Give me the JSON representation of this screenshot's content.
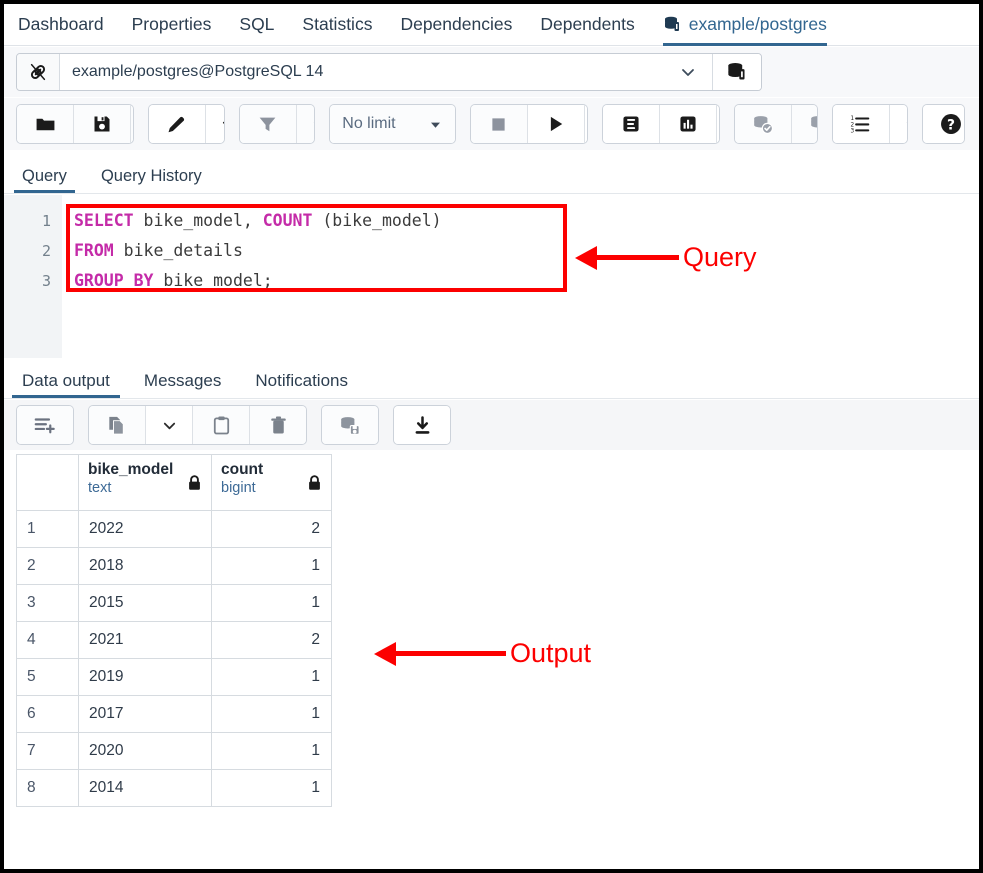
{
  "object_tabs": [
    {
      "label": "Dashboard",
      "active": false,
      "icon": null
    },
    {
      "label": "Properties",
      "active": false,
      "icon": null
    },
    {
      "label": "SQL",
      "active": false,
      "icon": null
    },
    {
      "label": "Statistics",
      "active": false,
      "icon": null
    },
    {
      "label": "Dependencies",
      "active": false,
      "icon": null
    },
    {
      "label": "Dependents",
      "active": false,
      "icon": null
    },
    {
      "label": "example/postgres",
      "active": true,
      "icon": "database-icon"
    }
  ],
  "connection_bar": {
    "link_icon": "connection-link-icon",
    "value": "example/postgres@PostgreSQL 14",
    "dropdown_caret": "⌄",
    "server_icon": "database-server-icon"
  },
  "toolbar": {
    "groups": [
      {
        "buttons": [
          {
            "name": "open-file-button",
            "icon": "folder-icon",
            "label": ""
          },
          {
            "name": "save-file-button",
            "icon": "save-disk-icon",
            "label": ""
          },
          {
            "name": "save-options-caret",
            "icon": "chevron-down-icon",
            "label": ""
          }
        ]
      },
      {
        "buttons": [
          {
            "name": "edit-button",
            "icon": "pencil-icon",
            "label": ""
          },
          {
            "name": "edit-options-caret",
            "icon": "chevron-down-icon",
            "label": ""
          }
        ]
      },
      {
        "buttons": [
          {
            "name": "filter-button",
            "icon": "funnel-icon",
            "label": ""
          },
          {
            "name": "filter-options-caret",
            "icon": "chevron-down-icon",
            "label": ""
          }
        ]
      },
      {
        "buttons": [
          {
            "name": "row-limit-select",
            "icon": "triangle-down-icon",
            "label": "No limit"
          }
        ]
      },
      {
        "buttons": [
          {
            "name": "stop-query-button",
            "icon": "stop-square-icon",
            "label": ""
          },
          {
            "name": "execute-query-button",
            "icon": "play-triangle-icon",
            "label": ""
          },
          {
            "name": "execute-options-caret",
            "icon": "chevron-down-icon",
            "label": ""
          }
        ]
      },
      {
        "buttons": [
          {
            "name": "explain-button",
            "icon": "explain-e-icon",
            "label": ""
          },
          {
            "name": "explain-analyze-button",
            "icon": "bar-chart-icon",
            "label": ""
          },
          {
            "name": "explain-options-caret",
            "icon": "chevron-down-icon",
            "label": ""
          }
        ]
      },
      {
        "buttons": [
          {
            "name": "commit-button",
            "icon": "database-check-icon",
            "label": ""
          },
          {
            "name": "rollback-button",
            "icon": "database-undo-icon",
            "label": ""
          }
        ]
      },
      {
        "buttons": [
          {
            "name": "macros-button",
            "icon": "list-ordered-icon",
            "label": ""
          },
          {
            "name": "macros-caret",
            "icon": "chevron-down-icon",
            "label": ""
          }
        ]
      },
      {
        "buttons": [
          {
            "name": "help-button",
            "icon": "question-circle-icon",
            "label": ""
          }
        ]
      }
    ]
  },
  "query_tabs": [
    {
      "label": "Query",
      "active": true
    },
    {
      "label": "Query History",
      "active": false
    }
  ],
  "editor": {
    "line_numbers": [
      "1",
      "2",
      "3"
    ],
    "lines": [
      [
        {
          "t": "SELECT",
          "kw": true
        },
        {
          "t": " bike_model, ",
          "kw": false
        },
        {
          "t": "COUNT",
          "kw": true
        },
        {
          "t": " (bike_model)",
          "kw": false
        }
      ],
      [
        {
          "t": "FROM",
          "kw": true
        },
        {
          "t": " bike_details",
          "kw": false
        }
      ],
      [
        {
          "t": "GROUP BY",
          "kw": true
        },
        {
          "t": " bike_model;",
          "kw": false
        }
      ]
    ]
  },
  "annotations": [
    {
      "name": "query-annotation",
      "label": "Query"
    },
    {
      "name": "output-annotation",
      "label": "Output"
    }
  ],
  "output_tabs": [
    {
      "label": "Data output",
      "active": true
    },
    {
      "label": "Messages",
      "active": false
    },
    {
      "label": "Notifications",
      "active": false
    }
  ],
  "output_toolbar": {
    "buttons": [
      {
        "name": "add-row-button",
        "icon": "add-row-icon"
      },
      {
        "name": "copy-button",
        "icon": "copy-pages-icon"
      },
      {
        "name": "copy-options-caret",
        "icon": "chevron-down-icon"
      },
      {
        "name": "paste-button",
        "icon": "clipboard-icon"
      },
      {
        "name": "delete-row-button",
        "icon": "trash-icon"
      },
      {
        "name": "save-data-changes-button",
        "icon": "database-save-icon"
      },
      {
        "name": "download-csv-button",
        "icon": "download-arrow-icon"
      }
    ]
  },
  "results": {
    "columns": [
      {
        "name": "",
        "type": "",
        "locked": false
      },
      {
        "name": "bike_model",
        "type": "text",
        "locked": true
      },
      {
        "name": "count",
        "type": "bigint",
        "locked": true
      }
    ],
    "rows": [
      {
        "num": "1",
        "bike_model": "2022",
        "count": "2"
      },
      {
        "num": "2",
        "bike_model": "2018",
        "count": "1"
      },
      {
        "num": "3",
        "bike_model": "2015",
        "count": "1"
      },
      {
        "num": "4",
        "bike_model": "2021",
        "count": "2"
      },
      {
        "num": "5",
        "bike_model": "2019",
        "count": "1"
      },
      {
        "num": "6",
        "bike_model": "2017",
        "count": "1"
      },
      {
        "num": "7",
        "bike_model": "2020",
        "count": "1"
      },
      {
        "num": "8",
        "bike_model": "2014",
        "count": "1"
      }
    ]
  },
  "colors": {
    "accent": "#326690",
    "keyword": "#c42ba8",
    "annotation": "#fc0000",
    "border": "#000000"
  }
}
